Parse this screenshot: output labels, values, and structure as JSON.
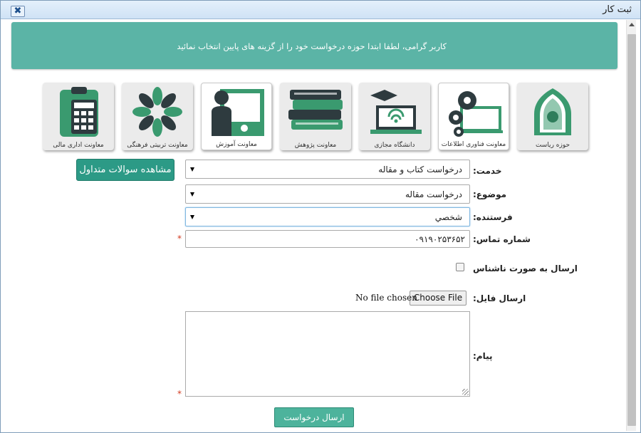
{
  "window": {
    "title": "ثبت کار",
    "close_label": "✖"
  },
  "banner": {
    "text": "کاربر گرامی، لطفا ابتدا حوزه درخواست خود را از گزینه های پایین انتخاب نمائید"
  },
  "tiles": [
    {
      "label": "حوزه ریاست"
    },
    {
      "label": "معاونت فناوری اطلاعات"
    },
    {
      "label": "دانشگاه مجازی"
    },
    {
      "label": "معاونت پژوهش"
    },
    {
      "label": "معاونت آموزش"
    },
    {
      "label": "معاونت تربیتی فرهنگی"
    },
    {
      "label": "معاونت اداری مالی"
    }
  ],
  "faq_button": {
    "label": "مشاهده سوالات متداول"
  },
  "form": {
    "service": {
      "label": "خدمت:",
      "value": "درخواست کتاب و مقاله"
    },
    "subject": {
      "label": "موضوع:",
      "value": "درخواست مقاله"
    },
    "sender": {
      "label": "فرستنده:",
      "value": "شخصي"
    },
    "phone": {
      "label": "شماره تماس:",
      "value": "۰۹۱۹۰۲۵۳۶۵۲",
      "required_mark": "*"
    },
    "anonymous": {
      "label": "ارسال به صورت ناشناس"
    },
    "file": {
      "label": "ارسال فایل:",
      "button": "Choose File",
      "status": "No file chosen"
    },
    "message": {
      "label": "پیام:",
      "required_mark": "*"
    },
    "submit": {
      "label": "ارسال درخواست"
    }
  },
  "colors": {
    "banner": "#5bb4a6",
    "accent": "#2c9a86",
    "icon_green": "#3a9a6f",
    "icon_dark": "#2e3b3f"
  }
}
